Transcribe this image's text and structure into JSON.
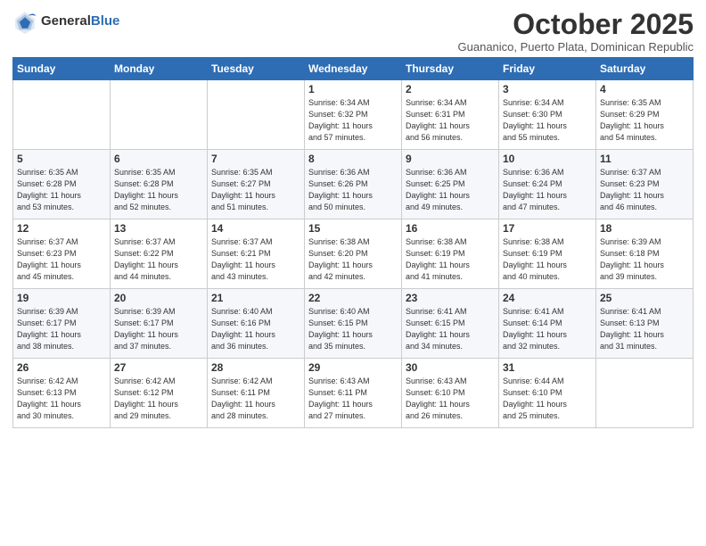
{
  "header": {
    "logo_general": "General",
    "logo_blue": "Blue",
    "month_title": "October 2025",
    "subtitle": "Guananico, Puerto Plata, Dominican Republic"
  },
  "days_of_week": [
    "Sunday",
    "Monday",
    "Tuesday",
    "Wednesday",
    "Thursday",
    "Friday",
    "Saturday"
  ],
  "weeks": [
    [
      {
        "day": "",
        "info": ""
      },
      {
        "day": "",
        "info": ""
      },
      {
        "day": "",
        "info": ""
      },
      {
        "day": "1",
        "info": "Sunrise: 6:34 AM\nSunset: 6:32 PM\nDaylight: 11 hours\nand 57 minutes."
      },
      {
        "day": "2",
        "info": "Sunrise: 6:34 AM\nSunset: 6:31 PM\nDaylight: 11 hours\nand 56 minutes."
      },
      {
        "day": "3",
        "info": "Sunrise: 6:34 AM\nSunset: 6:30 PM\nDaylight: 11 hours\nand 55 minutes."
      },
      {
        "day": "4",
        "info": "Sunrise: 6:35 AM\nSunset: 6:29 PM\nDaylight: 11 hours\nand 54 minutes."
      }
    ],
    [
      {
        "day": "5",
        "info": "Sunrise: 6:35 AM\nSunset: 6:28 PM\nDaylight: 11 hours\nand 53 minutes."
      },
      {
        "day": "6",
        "info": "Sunrise: 6:35 AM\nSunset: 6:28 PM\nDaylight: 11 hours\nand 52 minutes."
      },
      {
        "day": "7",
        "info": "Sunrise: 6:35 AM\nSunset: 6:27 PM\nDaylight: 11 hours\nand 51 minutes."
      },
      {
        "day": "8",
        "info": "Sunrise: 6:36 AM\nSunset: 6:26 PM\nDaylight: 11 hours\nand 50 minutes."
      },
      {
        "day": "9",
        "info": "Sunrise: 6:36 AM\nSunset: 6:25 PM\nDaylight: 11 hours\nand 49 minutes."
      },
      {
        "day": "10",
        "info": "Sunrise: 6:36 AM\nSunset: 6:24 PM\nDaylight: 11 hours\nand 47 minutes."
      },
      {
        "day": "11",
        "info": "Sunrise: 6:37 AM\nSunset: 6:23 PM\nDaylight: 11 hours\nand 46 minutes."
      }
    ],
    [
      {
        "day": "12",
        "info": "Sunrise: 6:37 AM\nSunset: 6:23 PM\nDaylight: 11 hours\nand 45 minutes."
      },
      {
        "day": "13",
        "info": "Sunrise: 6:37 AM\nSunset: 6:22 PM\nDaylight: 11 hours\nand 44 minutes."
      },
      {
        "day": "14",
        "info": "Sunrise: 6:37 AM\nSunset: 6:21 PM\nDaylight: 11 hours\nand 43 minutes."
      },
      {
        "day": "15",
        "info": "Sunrise: 6:38 AM\nSunset: 6:20 PM\nDaylight: 11 hours\nand 42 minutes."
      },
      {
        "day": "16",
        "info": "Sunrise: 6:38 AM\nSunset: 6:19 PM\nDaylight: 11 hours\nand 41 minutes."
      },
      {
        "day": "17",
        "info": "Sunrise: 6:38 AM\nSunset: 6:19 PM\nDaylight: 11 hours\nand 40 minutes."
      },
      {
        "day": "18",
        "info": "Sunrise: 6:39 AM\nSunset: 6:18 PM\nDaylight: 11 hours\nand 39 minutes."
      }
    ],
    [
      {
        "day": "19",
        "info": "Sunrise: 6:39 AM\nSunset: 6:17 PM\nDaylight: 11 hours\nand 38 minutes."
      },
      {
        "day": "20",
        "info": "Sunrise: 6:39 AM\nSunset: 6:17 PM\nDaylight: 11 hours\nand 37 minutes."
      },
      {
        "day": "21",
        "info": "Sunrise: 6:40 AM\nSunset: 6:16 PM\nDaylight: 11 hours\nand 36 minutes."
      },
      {
        "day": "22",
        "info": "Sunrise: 6:40 AM\nSunset: 6:15 PM\nDaylight: 11 hours\nand 35 minutes."
      },
      {
        "day": "23",
        "info": "Sunrise: 6:41 AM\nSunset: 6:15 PM\nDaylight: 11 hours\nand 34 minutes."
      },
      {
        "day": "24",
        "info": "Sunrise: 6:41 AM\nSunset: 6:14 PM\nDaylight: 11 hours\nand 32 minutes."
      },
      {
        "day": "25",
        "info": "Sunrise: 6:41 AM\nSunset: 6:13 PM\nDaylight: 11 hours\nand 31 minutes."
      }
    ],
    [
      {
        "day": "26",
        "info": "Sunrise: 6:42 AM\nSunset: 6:13 PM\nDaylight: 11 hours\nand 30 minutes."
      },
      {
        "day": "27",
        "info": "Sunrise: 6:42 AM\nSunset: 6:12 PM\nDaylight: 11 hours\nand 29 minutes."
      },
      {
        "day": "28",
        "info": "Sunrise: 6:42 AM\nSunset: 6:11 PM\nDaylight: 11 hours\nand 28 minutes."
      },
      {
        "day": "29",
        "info": "Sunrise: 6:43 AM\nSunset: 6:11 PM\nDaylight: 11 hours\nand 27 minutes."
      },
      {
        "day": "30",
        "info": "Sunrise: 6:43 AM\nSunset: 6:10 PM\nDaylight: 11 hours\nand 26 minutes."
      },
      {
        "day": "31",
        "info": "Sunrise: 6:44 AM\nSunset: 6:10 PM\nDaylight: 11 hours\nand 25 minutes."
      },
      {
        "day": "",
        "info": ""
      }
    ]
  ]
}
